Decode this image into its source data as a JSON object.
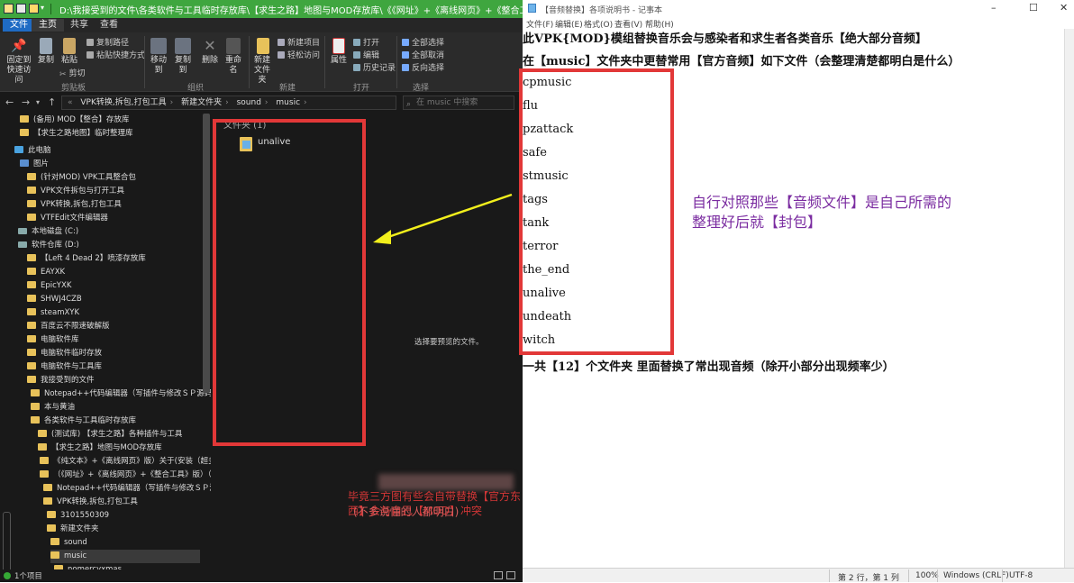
{
  "explorer": {
    "title": "D:\\我接受到的文件\\各类软件与工具临时存放库\\【求生之路】地图与MOD存放库\\《《网址》+《离线网页》+《整合工具》...",
    "ribbon_tabs": [
      "文件",
      "主页",
      "共享",
      "查看"
    ],
    "ribbon": {
      "pin_quick_access": "固定到快速访问",
      "copy": "复制",
      "paste": "粘贴",
      "copy_path": "复制路径",
      "paste_shortcut": "粘贴快捷方式",
      "cut": "剪切",
      "move_to": "移动到",
      "copy_to": "复制到",
      "delete": "删除",
      "rename": "重命名",
      "new_folder": "新建文件夹",
      "new_item": "新建项目",
      "easy_access": "轻松访问",
      "properties": "属性",
      "open": "打开",
      "edit": "编辑",
      "history": "历史记录",
      "select_all": "全部选择",
      "select_none": "全部取消",
      "invert_selection": "反向选择",
      "group_clipboard": "剪贴板",
      "group_organize": "组织",
      "group_new": "新建",
      "group_open": "打开",
      "group_select": "选择"
    },
    "address_crumbs": [
      "VPK转换,拆包,打包工具",
      "新建文件夹",
      "sound",
      "music"
    ],
    "search_placeholder": "在 music 中搜索",
    "tree": [
      "(备用) MOD【整合】存放库",
      "【求生之路地图】临时整理库",
      "此电脑",
      "图片",
      "(针对MOD) VPK工具整合包",
      "VPK文件拆包与打开工具",
      "VPK转换,拆包,打包工具",
      "VTFEdit文件编辑器",
      "本地磁盘 (C:)",
      "软件仓库 (D:)",
      "【Left 4 Dead 2】喷漆存放库",
      "EAYXK",
      "EpicYXK",
      "SHWJ4CZB",
      "steamXYK",
      "百度云不限速破解版",
      "电脑软件库",
      "电脑软件临时存放",
      "电脑软件与工具库",
      "我接受到的文件",
      "Notepad++代码编辑器（写插件与修改ＳＰ源码所用_",
      "本与黄油",
      "各类软件与工具临时存放库",
      "(测试库) 【求生之路】各种插件与工具",
      "【求生之路】地图与MOD存放库",
      "《纯文本》+《离线网页》版）关于(安装（超多）",
      "（《网址》+《离线网页》+《整合工具》版）（关",
      "Notepad++代码编辑器（写插件与修改ＳＰ源码",
      "VPK转换,拆包,打包工具",
      "3101550309",
      "新建文件夹",
      "sound",
      "music",
      "nomercyxmas"
    ],
    "group_header": "文件夹 (1)",
    "file_name": "unalive",
    "preview_text": "选择要预览的文件。",
    "status_count": "1个项目"
  },
  "annotations": {
    "right_line1": "自行对照那些【音频文件】是自己所需的",
    "right_line2": "整理好后就【封包】",
    "bottom_line1": "毕竟三方图有些会自带替换【官方东西】会与自己【MOD】冲突",
    "bottom_line2": "(不多说懂的人都明白)"
  },
  "notepad": {
    "title": "【音频替换】各项说明书 - 记事本",
    "menu": [
      "文件(F)",
      "编辑(E)",
      "格式(O)",
      "查看(V)",
      "帮助(H)"
    ],
    "lines": [
      "此VPK{MOD}模组替换音乐会与感染者和求生者各类音乐【绝大部分音频】",
      "在【music】文件夹中更替常用【官方音频】如下文件（会整理清楚都明白是什么）",
      "cpmusic",
      "flu",
      "pzattack",
      "safe",
      "stmusic",
      "tags",
      "tank",
      "terror",
      "the_end",
      "unalive",
      "undeath",
      "witch",
      "一共【12】个文件夹 里面替换了常出现音频（除开小部分出现频率少）"
    ],
    "status": {
      "position": "第 2 行，第 1 列",
      "zoom": "100%",
      "line_ending": "Windows (CRLF)",
      "encoding": "UTF-8"
    }
  },
  "colors": {
    "title_green": "#3fa63f",
    "annotation_red": "#e23838",
    "annotation_purple": "#7a2ba0",
    "arrow_yellow": "#f2ef1c"
  }
}
